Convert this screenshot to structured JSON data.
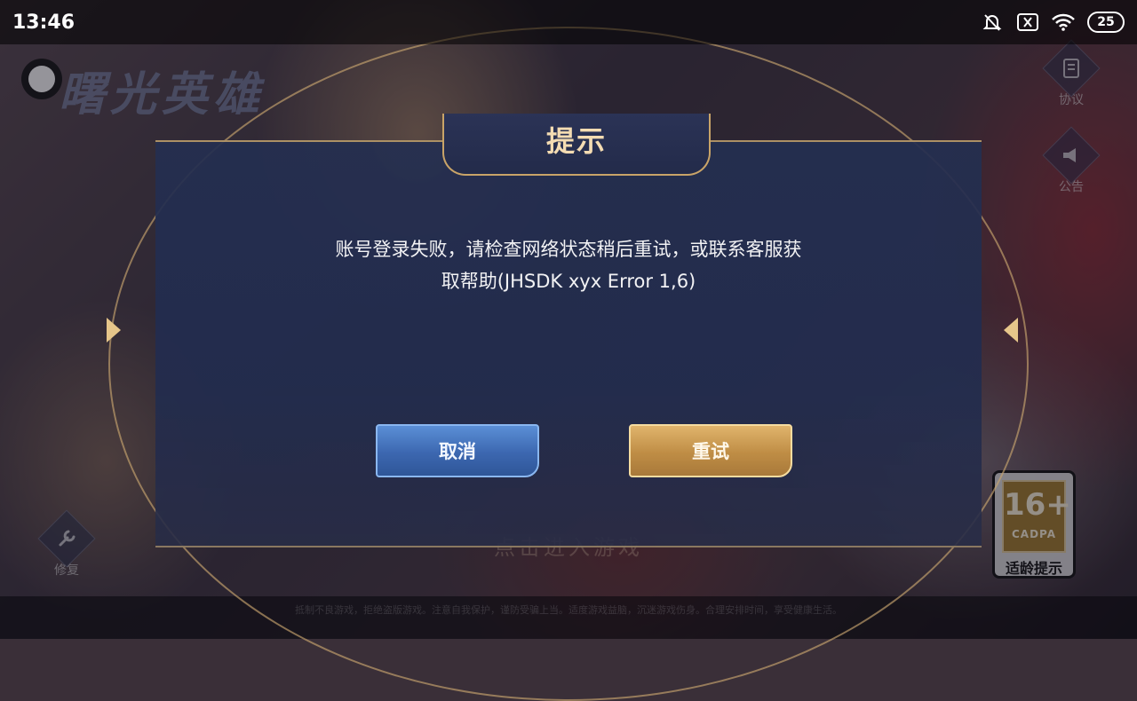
{
  "status_bar": {
    "time": "13:46",
    "icons": [
      "bell-off-icon",
      "sim-off-icon",
      "wifi-icon"
    ],
    "battery": "25"
  },
  "game": {
    "logo_text": "曙光英雄",
    "side_buttons": [
      {
        "label": "协议",
        "icon": "document-icon"
      },
      {
        "label": "公告",
        "icon": "megaphone-icon"
      }
    ],
    "repair_label": "修复",
    "enter_game": "点击进入游戏",
    "rating": {
      "age": "16+",
      "org": "CADPA",
      "label": "适龄提示"
    },
    "footer_text": "抵制不良游戏，拒绝盗版游戏。注意自我保护，谨防受骗上当。适度游戏益脑，沉迷游戏伤身。合理安排时间，享受健康生活。"
  },
  "dialog": {
    "title": "提示",
    "message_line1": "账号登录失败，请检查网络状态稍后重试，或联系客服获",
    "message_line2": "取帮助(JHSDK xyx Error 1,6)",
    "cancel_label": "取消",
    "retry_label": "重试"
  }
}
